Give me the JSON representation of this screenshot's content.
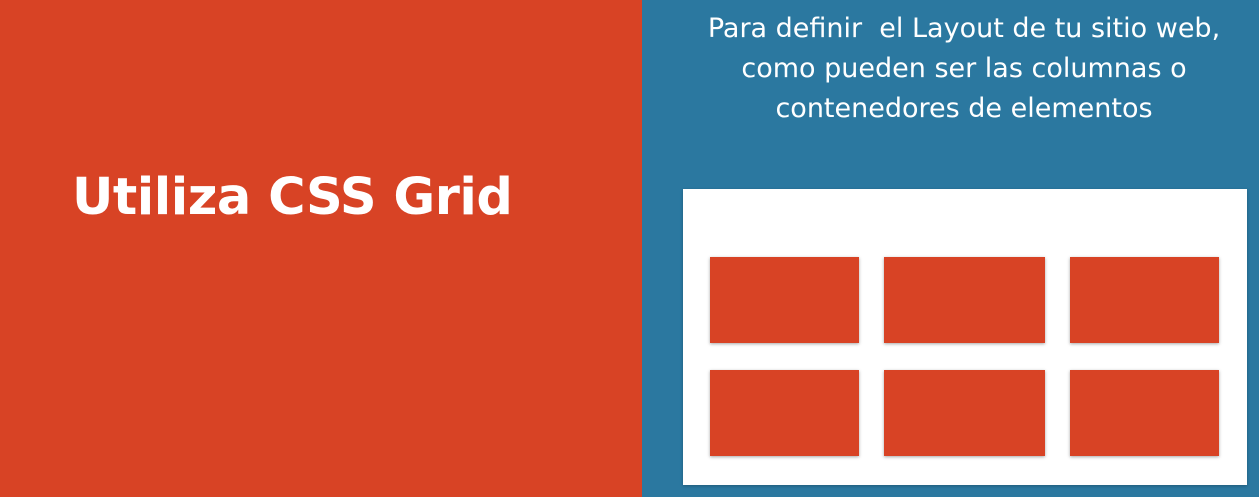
{
  "left": {
    "title": "Utiliza CSS Grid"
  },
  "right": {
    "description_lines": [
      "Para definir  el Layout de tu sitio web,",
      "como pueden ser las columnas o",
      "contenedores de elementos"
    ]
  },
  "colors": {
    "accent_red": "#d84325",
    "accent_blue": "#2b78a0",
    "white": "#ffffff"
  }
}
